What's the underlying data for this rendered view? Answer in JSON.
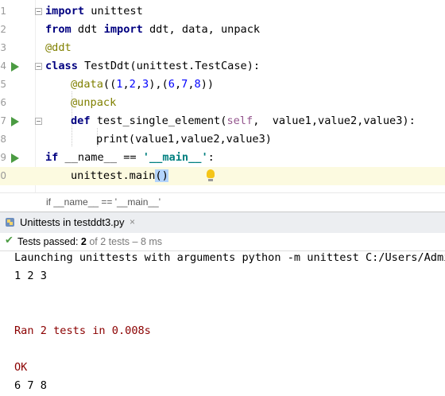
{
  "editor": {
    "line_numbers": [
      "1",
      "2",
      "3",
      "4",
      "5",
      "6",
      "7",
      "8",
      "9",
      "0"
    ],
    "lines": [
      [
        "import",
        " unittest"
      ],
      [
        "from",
        " ddt ",
        "import",
        " ddt, data, unpack"
      ],
      [
        "@ddt"
      ],
      [
        "class",
        " TestDdt(unittest.TestCase):"
      ],
      [
        "@data",
        "((",
        "1",
        ",",
        "2",
        ",",
        "3",
        "),(",
        "6",
        ",",
        "7",
        ",",
        "8",
        "))"
      ],
      [
        "@unpack"
      ],
      [
        "def",
        " test_single_element(",
        "self",
        ",  value1,value2,value3):"
      ],
      [
        "print(value1,value2,value3)"
      ],
      [
        "if",
        " __name__ == ",
        "'__main__'",
        ":"
      ],
      [
        "unittest.main",
        "()"
      ]
    ]
  },
  "breadcrumb": "if __name__ == '__main__'",
  "run_panel": {
    "tab_title": "Unittests in testddt3.py",
    "tab_close": "×",
    "status_prefix": "Tests passed: ",
    "status_count": "2",
    "status_suffix": " of 2 tests – 8 ms"
  },
  "console": {
    "lines": [
      "Launching unittests with arguments python -m unittest C:/Users/Admin",
      "1 2 3",
      "",
      "",
      "Ran 2 tests in 0.008s",
      "",
      "OK",
      "6 7 8"
    ]
  },
  "colors": {
    "keyword": "#000080",
    "decorator": "#808000",
    "number": "#0000ff",
    "string": "#008080",
    "run_green": "#4b9b42",
    "console_error": "#8b0000"
  }
}
